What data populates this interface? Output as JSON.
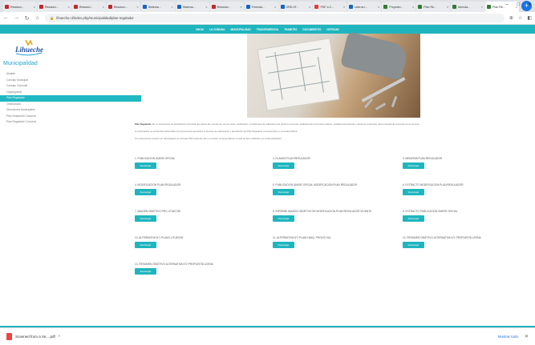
{
  "browser": {
    "tabs": [
      {
        "label": "Resoluci...",
        "color": "#c1272d"
      },
      {
        "label": "Resoluci...",
        "color": "#c1272d"
      },
      {
        "label": "Resoluci...",
        "color": "#c1272d"
      },
      {
        "label": "Resoluci...",
        "color": "#c1272d"
      },
      {
        "label": "Sistema...",
        "color": "#1565c0"
      },
      {
        "label": "Sistema...",
        "color": "#1565c0"
      },
      {
        "label": "Resoluci...",
        "color": "#c1272d"
      },
      {
        "label": "Formula...",
        "color": "#1565c0"
      },
      {
        "label": "ORD-0T...",
        "color": "#1565c0"
      },
      {
        "label": "PDF a C...",
        "color": "#e53935"
      },
      {
        "label": "nderos i...",
        "color": "#1565c0"
      },
      {
        "label": "Proyecto...",
        "color": "#2e7d32"
      },
      {
        "label": "Plan Re...",
        "color": "#2e7d32"
      },
      {
        "label": "formula...",
        "color": "#2e7d32"
      },
      {
        "label": "Plan Re...",
        "color": "#2e7d32",
        "active": true
      }
    ],
    "new_tab": "+",
    "url": "lihueche.cl/index.php/municipalidad/plan-regulador"
  },
  "topnav": [
    "INICIO",
    "LA COMUNA",
    "MUNICIPALIDAD",
    "TRANSPARENCIA",
    "TRAMITES",
    "DOCUMENTOS",
    "NOTICIAS"
  ],
  "sidebar": {
    "logo_text": "Lihueche",
    "title": "Municipalidad",
    "items": [
      {
        "label": "Alcalde"
      },
      {
        "label": "Concejo Municipal"
      },
      {
        "label": "Consejo Comunal"
      },
      {
        "label": "Organigrama"
      },
      {
        "label": "Plan Regulador",
        "active": true
      },
      {
        "label": "Ordenanzas"
      },
      {
        "label": "Direcciones Municipales"
      },
      {
        "label": "Plan Desarrollo Comunal"
      },
      {
        "label": "Plan Regulador Comunal"
      }
    ]
  },
  "content": {
    "intro_bold": "Plan Regulador.",
    "intro": "Es un instrumento de planificación territorial que define las normas de uso de suelo, zonificación y condiciones de edificación del territorio comunal, estableciendo los límites urbanos, vialidad estructurante y áreas de protección para el desarrollo armónico de la comuna.",
    "para2": "A continuación se encuentran disponibles los documentos asociados al proceso de elaboración y aprobación del Plan Regulador Comunal para su consulta pública.",
    "para3": "Los documentos pueden ser descargados en formato PDF haciendo clic en el botón correspondiente a cada archivo publicado por la Municipalidad."
  },
  "download_label": "Descargar",
  "documents": [
    {
      "label": "1. PUBLICACION DIARIO OFICIAL"
    },
    {
      "label": "2. PLANOS PLAN REGULADOR"
    },
    {
      "label": "3. MEMORIA PLAN REGULADOR"
    },
    {
      "label": "4. MODIFICACION PLAN REGULADOR"
    },
    {
      "label": "5. PUBLICACION DIARIO OFICIAL MODIFICACION PLAN REGULADOR"
    },
    {
      "label": "6. EXTRACTO MODIFICACION PLAN REGULADOR"
    },
    {
      "label": "7. IMAGEN OBJETIVO PRC LITUECHE"
    },
    {
      "label": "8. INFORME IMAGEN OBJETIVO DE MODIFICACION PLAN REGULADOR VIGENTE"
    },
    {
      "label": "9. EXTRACTO PUBLICACION DIARIO OFICIAL"
    },
    {
      "label": "10. ALTERNATIVA N°1 PLANO LITUECHE"
    },
    {
      "label": "11. ALTERNATIVA N°2 PLANO MAQ. PROVIS SUL"
    },
    {
      "label": "12. RESUMEN OBJETIVO ALTERNATIVA N°1 PROPUESTA LATINA"
    },
    {
      "label": "13. RESUMEN OBJETIVO ALTERNATIVA N°2 PROPUESTA LATINA"
    }
  ],
  "download_bar": {
    "file": "Scanned from a Xe....pdf",
    "chevron": "^",
    "show_all": "Mostrar todo"
  }
}
